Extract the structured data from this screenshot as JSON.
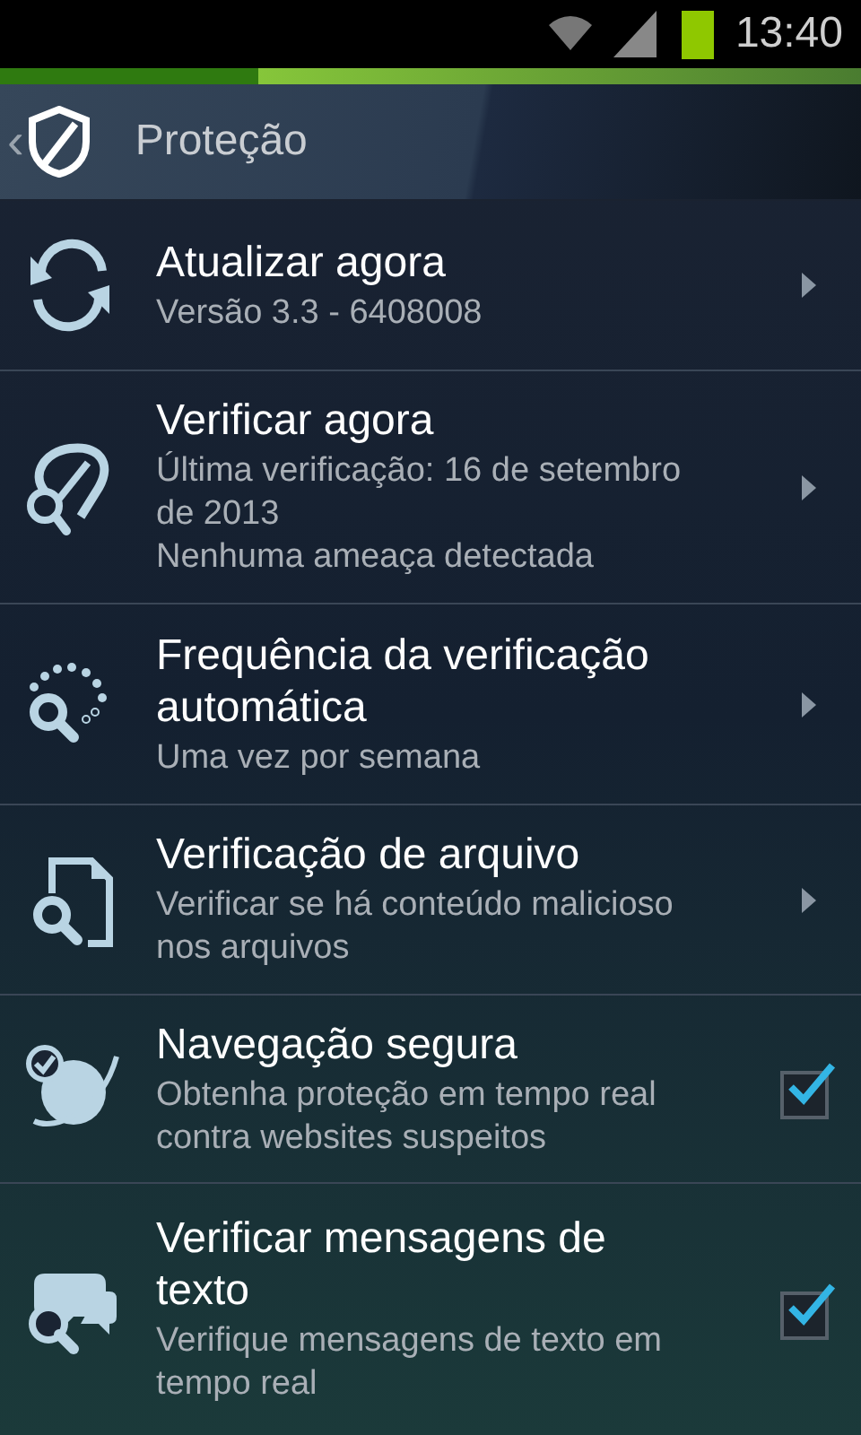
{
  "status_bar": {
    "time": "13:40"
  },
  "header": {
    "back": "‹",
    "title": "Proteção"
  },
  "items": [
    {
      "kind": "arrow",
      "title": "Atualizar agora",
      "subtitle": "Versão 3.3 - 6408008"
    },
    {
      "kind": "arrow",
      "title": "Verificar agora",
      "subtitle": "Última verificação: 16 de setembro de 2013\nNenhuma ameaça detectada"
    },
    {
      "kind": "arrow",
      "title": "Frequência da verificação automática",
      "subtitle": "Uma vez por semana"
    },
    {
      "kind": "arrow",
      "title": "Verificação de arquivo",
      "subtitle": "Verificar se há conteúdo malicioso nos arquivos"
    },
    {
      "kind": "checkbox",
      "checked": true,
      "title": "Navegação segura",
      "subtitle": "Obtenha proteção em tempo real contra websites suspeitos"
    },
    {
      "kind": "checkbox",
      "checked": true,
      "title": "Verificar mensagens de texto",
      "subtitle": "Verifique mensagens de texto em tempo real"
    }
  ]
}
